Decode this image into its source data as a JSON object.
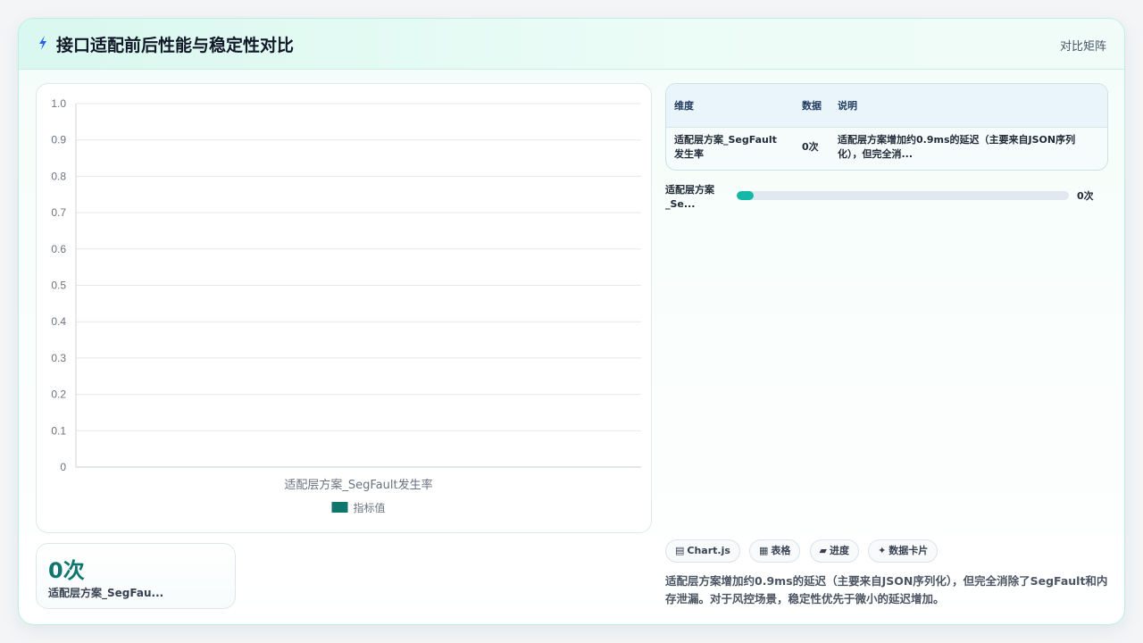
{
  "header": {
    "icon": "lightning-icon",
    "title": "接口适配前后性能与稳定性对比",
    "right_link": "对比矩阵"
  },
  "chart_data": {
    "type": "bar",
    "categories": [
      "适配层方案_SegFault发生率"
    ],
    "series": [
      {
        "name": "指标值",
        "values": [
          0
        ],
        "color": "#0f766e"
      }
    ],
    "ylim": [
      0,
      1.0
    ],
    "yticks": [
      "0",
      "0.1",
      "0.2",
      "0.3",
      "0.4",
      "0.5",
      "0.6",
      "0.7",
      "0.8",
      "0.9",
      "1.0"
    ],
    "grid": true,
    "legend_position": "bottom"
  },
  "stat_card": {
    "value": "0次",
    "label": "适配层方案_SegFau..."
  },
  "table": {
    "headers": [
      "维度",
      "数据",
      "说明"
    ],
    "rows": [
      {
        "dimension": "适配层方案_SegFault发生率",
        "data": "0次",
        "note": "适配层方案增加约0.9ms的延迟（主要来自JSON序列化），但完全消..."
      }
    ]
  },
  "progress": {
    "label": "适配层方案_Se...",
    "value_text": "0次",
    "fraction": 0
  },
  "chips": [
    {
      "icon": "chart-icon",
      "glyph": "▤",
      "label": "Chart.js"
    },
    {
      "icon": "table-icon",
      "glyph": "▦",
      "label": "表格"
    },
    {
      "icon": "progress-icon",
      "glyph": "▰",
      "label": "进度"
    },
    {
      "icon": "sparkle-icon",
      "glyph": "✦",
      "label": "数据卡片"
    }
  ],
  "summary": "适配层方案增加约0.9ms的延迟（主要来自JSON序列化），但完全消除了SegFault和内存泄漏。对于风控场景，稳定性优先于微小的延迟增加。",
  "colors": {
    "accent": "#0f766e",
    "progress_fill": "#14b8a6",
    "header_bg": "#d9f8ef"
  }
}
